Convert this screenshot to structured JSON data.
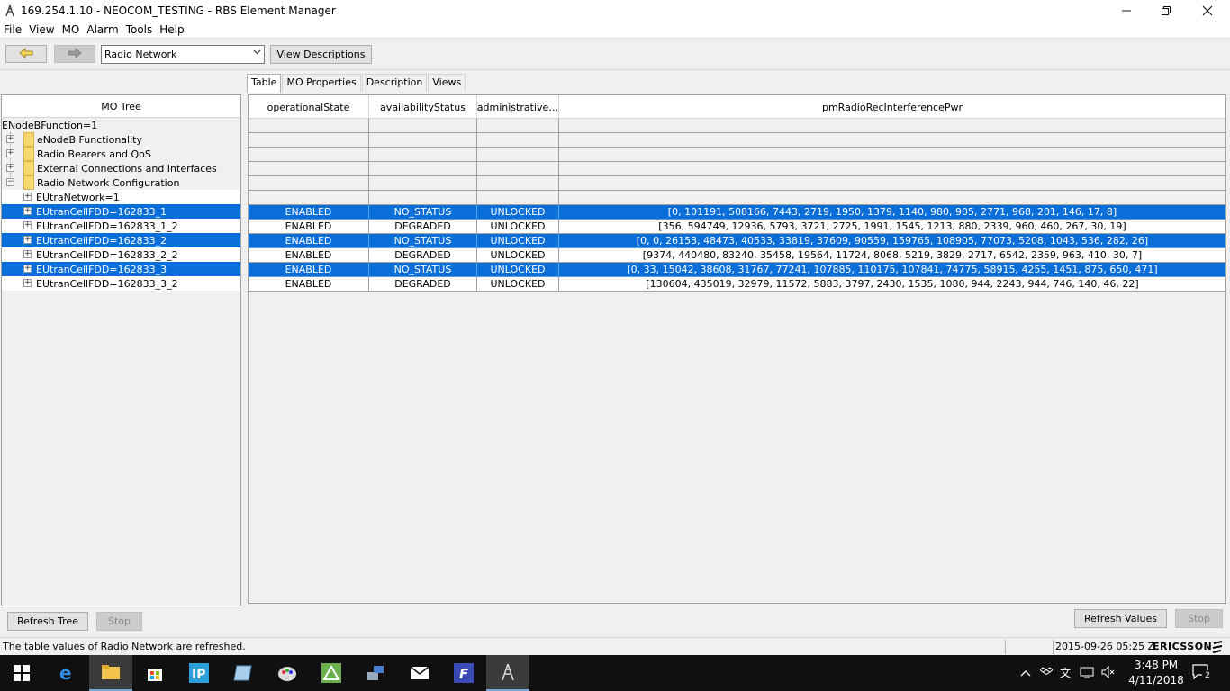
{
  "window": {
    "title": "169.254.1.10 - NEOCOM_TESTING - RBS Element Manager",
    "minimize_icon": "minimize-icon",
    "maximize_icon": "restore-icon",
    "close_icon": "close-icon"
  },
  "menu": [
    "File",
    "View",
    "MO",
    "Alarm",
    "Tools",
    "Help"
  ],
  "toolbar": {
    "back_icon": "arrow-left-icon",
    "forward_icon": "arrow-right-icon",
    "view_select_value": "Radio Network",
    "view_descriptions_label": "View Descriptions"
  },
  "left": {
    "header": "MO Tree",
    "root": "ENodeBFunction=1",
    "items": [
      {
        "label": "eNodeB Functionality",
        "icon": "folder-icon"
      },
      {
        "label": "Radio Bearers and QoS",
        "icon": "folder-icon"
      },
      {
        "label": "External Connections and Interfaces",
        "icon": "folder-icon"
      },
      {
        "label": "Radio Network Configuration",
        "icon": "folder-open-icon"
      }
    ],
    "children": [
      {
        "label": "EUtraNetwork=1",
        "selected": false
      },
      {
        "label": "EUtranCellFDD=162833_1",
        "selected": true
      },
      {
        "label": "EUtranCellFDD=162833_1_2",
        "selected": false
      },
      {
        "label": "EUtranCellFDD=162833_2",
        "selected": true
      },
      {
        "label": "EUtranCellFDD=162833_2_2",
        "selected": false
      },
      {
        "label": "EUtranCellFDD=162833_3",
        "selected": true
      },
      {
        "label": "EUtranCellFDD=162833_3_2",
        "selected": false
      }
    ],
    "refresh_tree_label": "Refresh Tree",
    "stop_label": "Stop"
  },
  "tabs": [
    "Table",
    "MO Properties",
    "Description",
    "Views"
  ],
  "table": {
    "columns": [
      "operationalState",
      "availabilityStatus",
      "administrative…",
      "pmRadioRecInterferencePwr"
    ],
    "rows": [
      {
        "op": "ENABLED",
        "avail": "NO_STATUS",
        "admin": "UNLOCKED",
        "pm": "[0, 101191, 508166, 7443, 2719, 1950, 1379, 1140, 980, 905, 2771, 968, 201, 146, 17, 8]",
        "selected": true
      },
      {
        "op": "ENABLED",
        "avail": "DEGRADED",
        "admin": "UNLOCKED",
        "pm": "[356, 594749, 12936, 5793, 3721, 2725, 1991, 1545, 1213, 880, 2339, 960, 460, 267, 30, 19]",
        "selected": false
      },
      {
        "op": "ENABLED",
        "avail": "NO_STATUS",
        "admin": "UNLOCKED",
        "pm": "[0, 0, 26153, 48473, 40533, 33819, 37609, 90559, 159765, 108905, 77073, 5208, 1043, 536, 282, 26]",
        "selected": true
      },
      {
        "op": "ENABLED",
        "avail": "DEGRADED",
        "admin": "UNLOCKED",
        "pm": "[9374, 440480, 83240, 35458, 19564, 11724, 8068, 5219, 3829, 2717, 6542, 2359, 963, 410, 30, 7]",
        "selected": false
      },
      {
        "op": "ENABLED",
        "avail": "NO_STATUS",
        "admin": "UNLOCKED",
        "pm": "[0, 33, 15042, 38608, 31767, 77241, 107885, 110175, 107841, 74775, 58915, 4255, 1451, 875, 650, 471]",
        "selected": true
      },
      {
        "op": "ENABLED",
        "avail": "DEGRADED",
        "admin": "UNLOCKED",
        "pm": "[130604, 435019, 32979, 11572, 5883, 3797, 2430, 1535, 1080, 944, 2243, 944, 746, 140, 46, 22]",
        "selected": false
      }
    ],
    "refresh_values_label": "Refresh Values",
    "stop_label": "Stop"
  },
  "status": {
    "message": "The table values of Radio Network are refreshed.",
    "datetime": "2015-09-26 05:25 Z",
    "brand": "ERICSSON"
  },
  "taskbar": {
    "time": "3:48 PM",
    "date": "4/11/2018",
    "notifications": "2",
    "icons": [
      "windows-start-icon",
      "edge-icon",
      "file-explorer-icon",
      "store-icon",
      "ip-tool-icon",
      "notepad-icon",
      "paint-icon",
      "app-triangle-icon",
      "network-tool-icon",
      "mail-icon",
      "app-f-icon",
      "rbs-element-manager-icon"
    ]
  },
  "colors": {
    "selection": "#0a6ed8",
    "taskbar": "#101010"
  }
}
